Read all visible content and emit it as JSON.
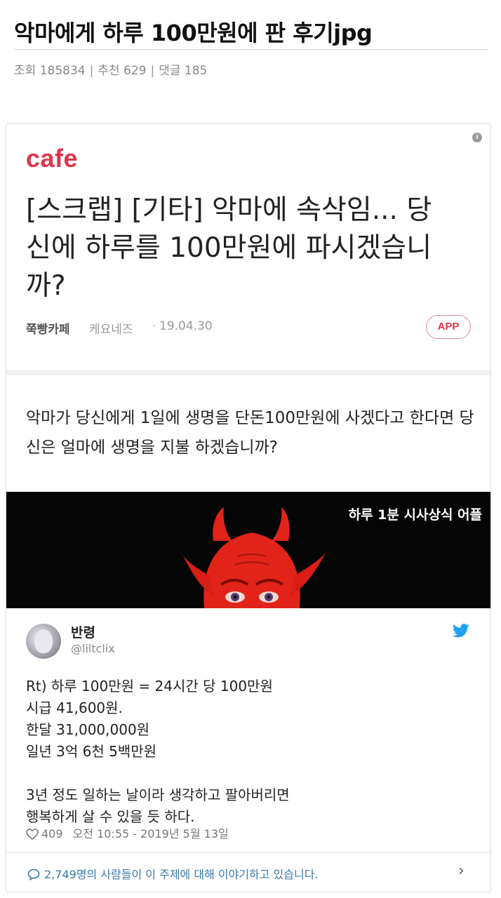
{
  "post": {
    "title": "악마에게 하루 100만원에 판 후기jpg",
    "meta": {
      "views_label": "조회",
      "views": "185834",
      "recommend_label": "추천",
      "recommend": "629",
      "comments_label": "댓글",
      "comments": "185",
      "separator": "|"
    }
  },
  "cafe_card": {
    "logo": "cafe",
    "info_icon": "i",
    "headline": "[스크랩] [기타] 악마에 속삭임... 당신에 하루를 100만원에 파시겠습니까?",
    "source": "쭉빵카페",
    "author": "케요네즈",
    "dot": "·",
    "date": "19.04.30",
    "app_button": "APP",
    "question": "악마가 당신에게 1일에 생명을 단돈100만원에 사겠다고 한다면 당신은 얼마에 생명을 지불 하겠습니까?",
    "banner_caption": "하루 1분 시사상식 어플"
  },
  "tweet": {
    "name": "반령",
    "handle": "@liltclix",
    "lines": [
      "Rt) 하루 100만원 = 24시간 당 100만원",
      "시급 41,600원.",
      "한달 31,000,000원",
      "일년 3억 6천 5백만원"
    ],
    "lines2": [
      "3년 정도 일하는 날이라 생각하고 팔아버리면",
      "행복하게 살 수 있을 듯 하다."
    ],
    "likes": "409",
    "timestamp": "오전 10:55 - 2019년 5월 13일",
    "talk": "2,749명의 사람들이 이 주제에 대해 이야기하고 있습니다.",
    "chevron": "›"
  },
  "colors": {
    "cafe_red": "#e0344a",
    "twitter_blue": "#1da1f2",
    "link_blue": "#3c79a8",
    "devil_red": "#e2231a"
  }
}
